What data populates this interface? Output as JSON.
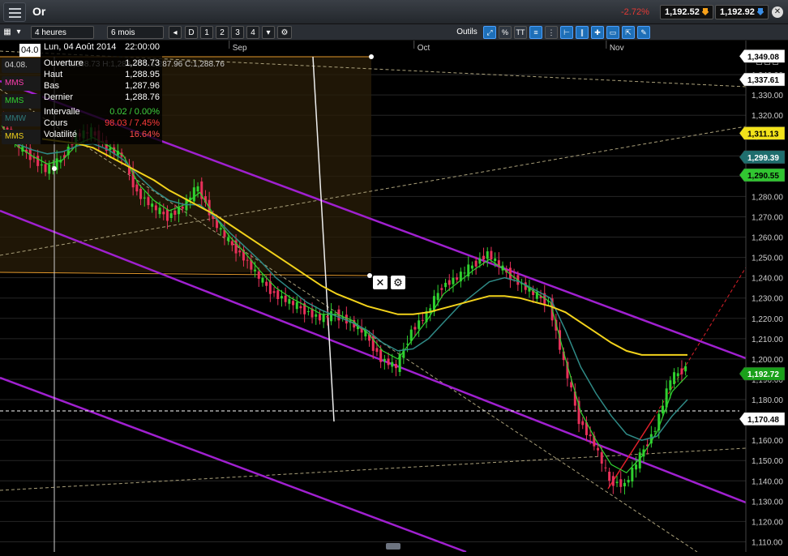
{
  "app": {
    "title": "Or",
    "change_pct": "-2.72%",
    "bid": "1,192.52",
    "ask": "1,192.92",
    "accent": "#e53935"
  },
  "toolbar": {
    "interval": "4 heures",
    "period": "6 mois",
    "buttons": [
      "D",
      "1",
      "2",
      "3",
      "4"
    ],
    "tools_label": "Outils",
    "percent_label": "%",
    "text_tool": "TT"
  },
  "info_panel": {
    "date": "Lun, 04 Août 2014",
    "time": "22:00:00",
    "rows": [
      {
        "label": "Ouverture",
        "value": "1,288.73"
      },
      {
        "label": "Haut",
        "value": "1,288.95"
      },
      {
        "label": "Bas",
        "value": "1,287.96"
      },
      {
        "label": "Dernier",
        "value": "1,288.76"
      }
    ],
    "stats": [
      {
        "label": "Intervalle",
        "value": "0.02 / 0.00%",
        "color": "#3fd23f"
      },
      {
        "label": "Cours",
        "value": "98.03 / 7.45%",
        "color": "#ff3b3b"
      },
      {
        "label": "Volatilité",
        "value": "16.64%",
        "color": "#ff4d4d"
      }
    ]
  },
  "header_strip": {
    "date_badge": "04.0",
    "ohlc": "O:1,288.73  H:1,288.95  L:1,287.96  C:1,288.76"
  },
  "legend": [
    {
      "code": "04.08.",
      "color": "#cfcfcf"
    },
    {
      "code": "MMS",
      "color": "#ff3fb0"
    },
    {
      "code": "MMS",
      "color": "#31d331"
    },
    {
      "code": "MMW",
      "color": "#2f7a7a"
    },
    {
      "code": "MMS",
      "color": "#f2d21b"
    }
  ],
  "chart_data": {
    "type": "candlestick",
    "instrument": "Or",
    "x_tick_labels": [
      "Sep",
      "Oct",
      "Nov"
    ],
    "y_ticks": [
      1110,
      1120,
      1130,
      1140,
      1150,
      1160,
      1170,
      1180,
      1190,
      1200,
      1210,
      1220,
      1230,
      1240,
      1250,
      1260,
      1270,
      1280,
      1290,
      1300,
      1310,
      1320,
      1330,
      1340
    ],
    "ylim": [
      1105,
      1352
    ],
    "series": [
      {
        "name": "close",
        "x": [
          0,
          4,
          8,
          12,
          16,
          20,
          24,
          28,
          32,
          36,
          40,
          44,
          48,
          52,
          56,
          60,
          64,
          68,
          72,
          76,
          80,
          84,
          88,
          92,
          96,
          100,
          104,
          108,
          112,
          116,
          120,
          124,
          128,
          132,
          136,
          140,
          144,
          148,
          152,
          156,
          160,
          164,
          168,
          172,
          176,
          180
        ],
        "values": [
          1318,
          1306,
          1300,
          1293,
          1298,
          1310,
          1312,
          1304,
          1300,
          1282,
          1275,
          1270,
          1275,
          1285,
          1268,
          1258,
          1250,
          1240,
          1232,
          1228,
          1224,
          1220,
          1222,
          1218,
          1212,
          1200,
          1196,
          1214,
          1222,
          1236,
          1240,
          1246,
          1252,
          1244,
          1238,
          1232,
          1228,
          1198,
          1170,
          1158,
          1140,
          1138,
          1152,
          1166,
          1190,
          1196
        ]
      },
      {
        "name": "MMS",
        "values": [
          1315,
          1305,
          1300,
          1296,
          1298,
          1306,
          1309,
          1305,
          1300,
          1286,
          1278,
          1273,
          1276,
          1282,
          1270,
          1260,
          1252,
          1243,
          1235,
          1230,
          1226,
          1222,
          1222,
          1219,
          1213,
          1204,
          1200,
          1210,
          1220,
          1232,
          1238,
          1244,
          1249,
          1244,
          1238,
          1233,
          1228,
          1200,
          1174,
          1160,
          1148,
          1144,
          1152,
          1164,
          1184,
          1192
        ]
      },
      {
        "name": "MMW",
        "values": [
          1312,
          1306,
          1303,
          1301,
          1302,
          1305,
          1306,
          1303,
          1298,
          1290,
          1283,
          1278,
          1276,
          1276,
          1270,
          1262,
          1255,
          1248,
          1240,
          1234,
          1228,
          1224,
          1221,
          1218,
          1214,
          1208,
          1204,
          1205,
          1210,
          1218,
          1226,
          1232,
          1238,
          1240,
          1238,
          1234,
          1230,
          1214,
          1196,
          1183,
          1172,
          1163,
          1160,
          1162,
          1172,
          1180
        ]
      },
      {
        "name": "MMS",
        "values": [
          1310,
          1310,
          1309,
          1308,
          1307,
          1306,
          1304,
          1300,
          1296,
          1292,
          1288,
          1283,
          1279,
          1275,
          1271,
          1266,
          1261,
          1256,
          1251,
          1246,
          1241,
          1236,
          1232,
          1229,
          1226,
          1224,
          1222,
          1222,
          1223,
          1225,
          1227,
          1229,
          1231,
          1231,
          1230,
          1228,
          1226,
          1223,
          1218,
          1213,
          1208,
          1204,
          1202,
          1202,
          1202,
          1202
        ]
      }
    ],
    "price_labels": [
      {
        "text": "1,349.08",
        "value": 1349.08,
        "bg": "#ffffff",
        "fg": "#000000"
      },
      {
        "text": "1,337.61",
        "value": 1337.61,
        "bg": "#ffffff",
        "fg": "#000000"
      },
      {
        "text": "1,311.13",
        "value": 1311.13,
        "bg": "#f2e21b",
        "fg": "#000000"
      },
      {
        "text": "1,299.39",
        "value": 1299.39,
        "bg": "#1f6e6e",
        "fg": "#ffffff"
      },
      {
        "text": "1,290.55",
        "value": 1290.55,
        "bg": "#31c531",
        "fg": "#000000"
      },
      {
        "text": "1,192.72",
        "value": 1192.72,
        "bg": "#1aa01a",
        "fg": "#ffffff"
      },
      {
        "text": "1,170.48",
        "value": 1170.48,
        "bg": "#ffffff",
        "fg": "#000000"
      }
    ],
    "grid": true
  }
}
